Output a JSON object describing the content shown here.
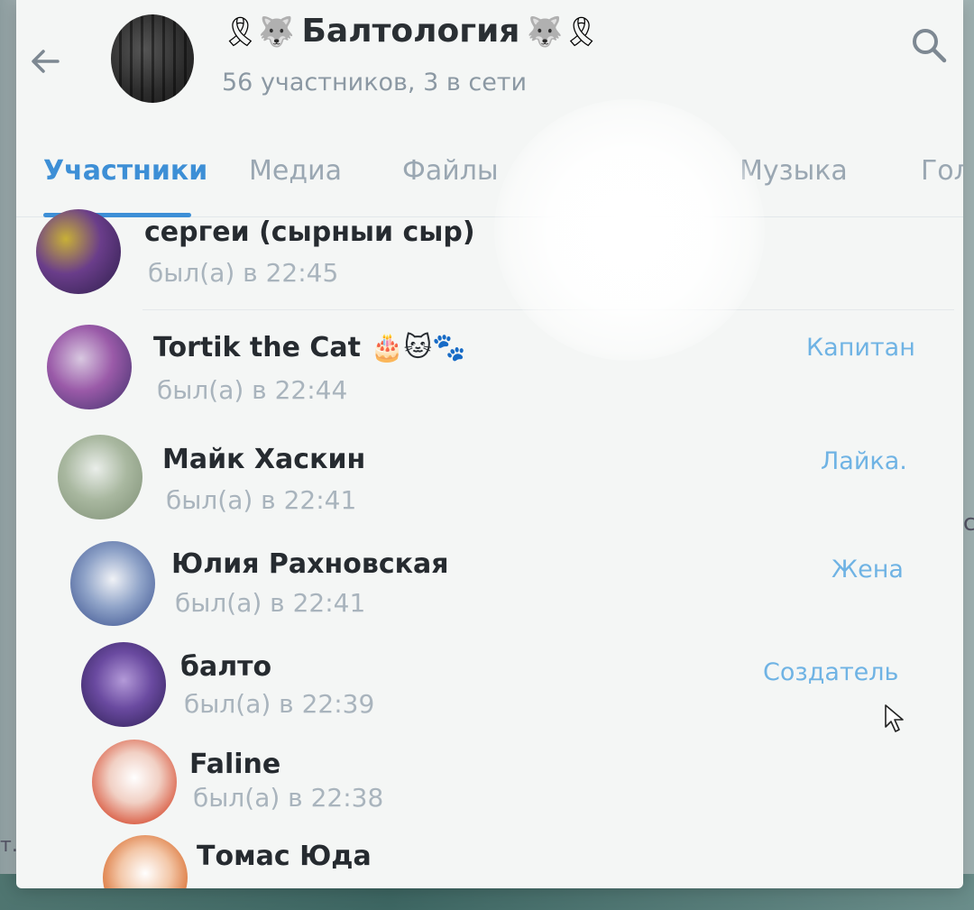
{
  "header": {
    "title": "Балтология",
    "title_emoji_left": "🎗🐺",
    "title_emoji_right": "🐺🎗",
    "subtitle": "56 участников, 3 в сети"
  },
  "tabs": [
    {
      "label": "Участники",
      "active": true
    },
    {
      "label": "Медиа",
      "active": false
    },
    {
      "label": "Файлы",
      "active": false
    },
    {
      "label": "Музыка",
      "active": false
    },
    {
      "label": "Гол",
      "active": false
    }
  ],
  "members": [
    {
      "name": "сергеи (сырныи сыр)",
      "status": "был(а) в 22:45",
      "role": ""
    },
    {
      "name": "Tortik the Cat",
      "emoji": "🎂🐱🐾",
      "status": "был(а) в 22:44",
      "role": "Капитан"
    },
    {
      "name": "Майк Хаскин",
      "status": "был(а) в 22:41",
      "role": "Лайка."
    },
    {
      "name": "Юлия Рахновская",
      "status": "был(а) в 22:41",
      "role": "Жена"
    },
    {
      "name": "балто",
      "status": "был(а) в 22:39",
      "role": "Создатель"
    },
    {
      "name": "Faline",
      "status": "был(а) в 22:38",
      "role": ""
    },
    {
      "name": "Томас Юда",
      "status": "",
      "role": ""
    }
  ],
  "side_fragments": {
    "right": "ос",
    "left": "т..."
  },
  "colors": {
    "accent": "#3d8fd6",
    "role": "#6fb3e4",
    "status": "#a9b4bd"
  }
}
